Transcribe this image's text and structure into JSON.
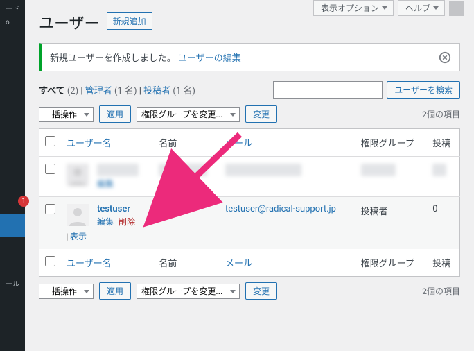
{
  "topbar": {
    "options_label": "表示オプション",
    "help_label": "ヘルプ"
  },
  "sidebar": {
    "badge_count": "1",
    "partial_top_text": "ード",
    "partial_bottom_text": "ール",
    "partial_item_o": "o"
  },
  "header": {
    "title": "ユーザー",
    "add_new": "新規追加"
  },
  "notice": {
    "text": "新規ユーザーを作成しました。",
    "link": "ユーザーの編集"
  },
  "filters": {
    "all_label": "すべて",
    "all_count": "(2)",
    "admin_label": "管理者",
    "admin_count": "(1 名)",
    "contributor_label": "投稿者",
    "contributor_count": "(1 名)",
    "search_button": "ユーザーを検索"
  },
  "tablenav": {
    "bulk_action": "一括操作",
    "apply": "適用",
    "role_change": "権限グループを変更...",
    "change": "変更",
    "item_count": "2個の項目"
  },
  "columns": {
    "username": "ユーザー名",
    "name": "名前",
    "email": "メール",
    "role": "権限グループ",
    "posts": "投稿"
  },
  "rows": {
    "blurred_edit": "編集",
    "user2": {
      "username": "testuser",
      "name": "—",
      "email": "testuser@radical-support.jp",
      "role": "投稿者",
      "posts": "0",
      "edit": "編集",
      "delete": "削除",
      "view": "表示"
    }
  }
}
